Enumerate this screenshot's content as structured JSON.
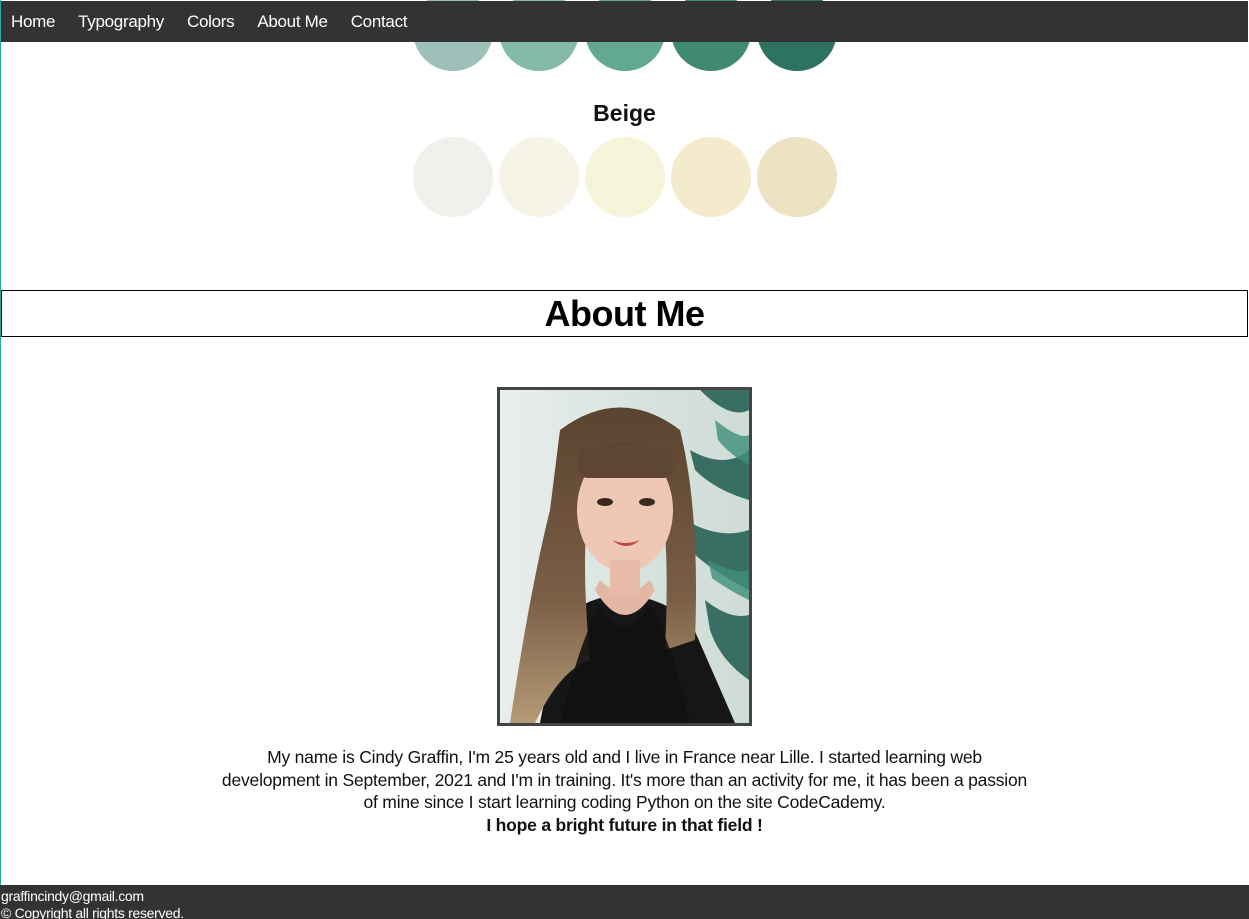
{
  "nav": {
    "items": [
      "Home",
      "Typography",
      "Colors",
      "About Me",
      "Contact"
    ]
  },
  "colors": {
    "green_palette": [
      "#9dc0b9",
      "#83bba8",
      "#62a893",
      "#408a73",
      "#2e7362"
    ],
    "beige_heading": "Beige",
    "beige_palette": [
      "#f0f0ed",
      "#f5f4e6",
      "#f6f5da",
      "#f3ebcb",
      "#ede2c1"
    ]
  },
  "about": {
    "heading": "About Me",
    "photo_alt": "Portrait photo",
    "bio": "My name is Cindy Graffin, I'm 25 years old and I live in France near Lille. I started learning web development in September, 2021 and I'm in training. It's more than an activity for me, it has been a passion of mine since I start learning coding Python on the site CodeCademy.",
    "closing": "I hope a bright future in that field !"
  },
  "footer": {
    "email": "graffincindy@gmail.com",
    "copyright": "© Copyright all rights reserved."
  }
}
